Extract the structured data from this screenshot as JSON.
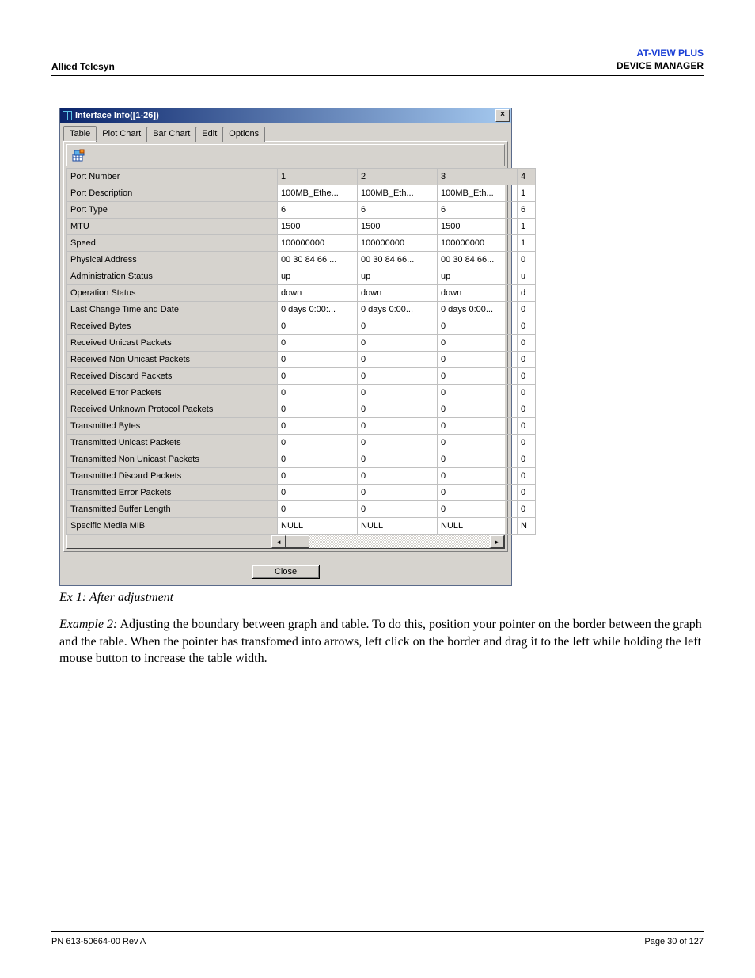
{
  "header": {
    "left": "Allied Telesyn",
    "right1": "AT-VIEW PLUS",
    "right2": "DEVICE MANAGER"
  },
  "footer": {
    "left": "PN 613-50664-00 Rev A",
    "right": "Page 30 of 127"
  },
  "window": {
    "title": "Interface Info([1-26])",
    "tabs": [
      "Table",
      "Plot Chart",
      "Bar Chart",
      "Edit",
      "Options"
    ],
    "close_btn": "Close",
    "columns": [
      "1",
      "2",
      "3",
      "4"
    ],
    "rows": [
      {
        "name": "Port Number",
        "v": [
          "1",
          "2",
          "3",
          "4"
        ]
      },
      {
        "name": "Port Description",
        "v": [
          "100MB_Ethe...",
          "100MB_Eth...",
          "100MB_Eth...",
          "1"
        ]
      },
      {
        "name": "Port Type",
        "v": [
          "6",
          "6",
          "6",
          "6"
        ]
      },
      {
        "name": "MTU",
        "v": [
          "1500",
          "1500",
          "1500",
          "1"
        ]
      },
      {
        "name": "Speed",
        "v": [
          "100000000",
          "100000000",
          "100000000",
          "1"
        ]
      },
      {
        "name": "Physical Address",
        "v": [
          "00 30 84 66 ...",
          "00 30 84 66...",
          "00 30 84 66...",
          "0"
        ]
      },
      {
        "name": "Administration Status",
        "v": [
          "up",
          "up",
          "up",
          "u"
        ]
      },
      {
        "name": "Operation Status",
        "v": [
          "down",
          "down",
          "down",
          "d"
        ]
      },
      {
        "name": "Last Change Time and Date",
        "v": [
          "0 days 0:00:...",
          "0 days 0:00...",
          "0 days 0:00...",
          "0"
        ]
      },
      {
        "name": "Received Bytes",
        "v": [
          "0",
          "0",
          "0",
          "0"
        ]
      },
      {
        "name": "Received Unicast Packets",
        "v": [
          "0",
          "0",
          "0",
          "0"
        ]
      },
      {
        "name": "Received Non Unicast Packets",
        "v": [
          "0",
          "0",
          "0",
          "0"
        ]
      },
      {
        "name": "Received Discard Packets",
        "v": [
          "0",
          "0",
          "0",
          "0"
        ]
      },
      {
        "name": "Received Error Packets",
        "v": [
          "0",
          "0",
          "0",
          "0"
        ]
      },
      {
        "name": "Received Unknown Protocol Packets",
        "v": [
          "0",
          "0",
          "0",
          "0"
        ]
      },
      {
        "name": "Transmitted Bytes",
        "v": [
          "0",
          "0",
          "0",
          "0"
        ]
      },
      {
        "name": "Transmitted Unicast Packets",
        "v": [
          "0",
          "0",
          "0",
          "0"
        ]
      },
      {
        "name": "Transmitted Non Unicast Packets",
        "v": [
          "0",
          "0",
          "0",
          "0"
        ]
      },
      {
        "name": "Transmitted Discard Packets",
        "v": [
          "0",
          "0",
          "0",
          "0"
        ]
      },
      {
        "name": "Transmitted Error Packets",
        "v": [
          "0",
          "0",
          "0",
          "0"
        ]
      },
      {
        "name": "Transmitted Buffer Length",
        "v": [
          "0",
          "0",
          "0",
          "0"
        ]
      },
      {
        "name": "Specific Media MIB",
        "v": [
          "NULL",
          "NULL",
          "NULL",
          "N"
        ]
      }
    ]
  },
  "caption": "Ex 1: After adjustment",
  "example2_lead": "Example 2:",
  "example2_text": " Adjusting the boundary between graph and table. To do this, position your pointer on the border between the graph and the table. When the pointer has transfomed into arrows, left click on the border and drag it to the left while holding the left mouse button to increase the table width."
}
